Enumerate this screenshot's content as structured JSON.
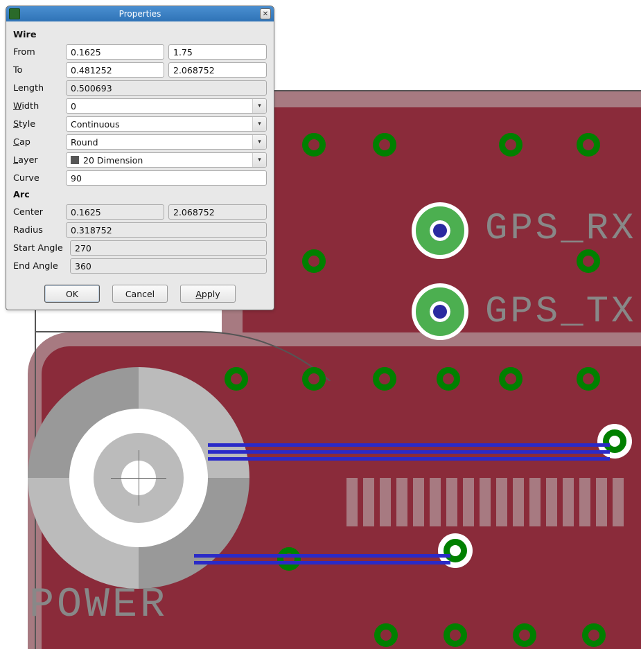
{
  "window": {
    "title": "Properties",
    "close_glyph": "✕"
  },
  "sections": {
    "wire": "Wire",
    "arc": "Arc"
  },
  "labels": {
    "from": "From",
    "to": "To",
    "length": "Length",
    "width": "Width",
    "style": "Style",
    "cap": "Cap",
    "layer": "Layer",
    "curve": "Curve",
    "center": "Center",
    "radius": "Radius",
    "start_angle": "Start Angle",
    "end_angle": "End Angle"
  },
  "wire": {
    "from_x": "0.1625",
    "from_y": "1.75",
    "to_x": "0.481252",
    "to_y": "2.068752",
    "length": "0.500693",
    "width": "0",
    "style": "Continuous",
    "cap": "Round",
    "layer": "20 Dimension",
    "curve": "90"
  },
  "arc": {
    "center_x": "0.1625",
    "center_y": "2.068752",
    "radius": "0.318752",
    "start_angle": "270",
    "end_angle": "360"
  },
  "buttons": {
    "ok": "OK",
    "cancel": "Cancel",
    "apply": "Apply"
  },
  "pcb": {
    "silk_power": "POWER",
    "silk_gps_rx": "GPS_RX",
    "silk_gps_tx": "GPS_TX"
  }
}
